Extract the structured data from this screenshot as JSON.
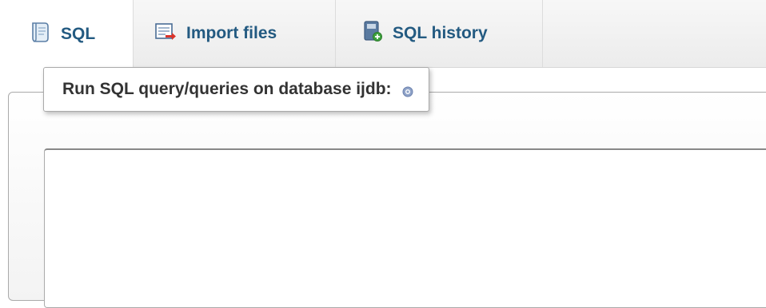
{
  "tabs": [
    {
      "label": "SQL",
      "icon": "sql-icon",
      "active": true
    },
    {
      "label": "Import files",
      "icon": "import-icon",
      "active": false
    },
    {
      "label": "SQL history",
      "icon": "history-icon",
      "active": false
    }
  ],
  "fieldset": {
    "legend": "Run SQL query/queries on database ijdb:",
    "help_icon": "help-icon"
  },
  "query_box": {
    "value": ""
  },
  "colors": {
    "link": "#235a81",
    "legend_text": "#333333",
    "border": "#aaaaaa"
  }
}
